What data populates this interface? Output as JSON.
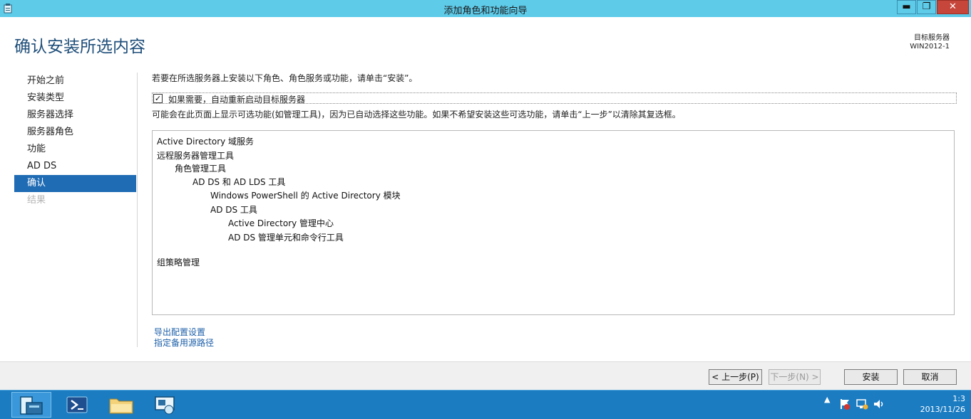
{
  "window": {
    "title": "添加角色和功能向导",
    "min_glyph": "▬",
    "max_glyph": "❐",
    "close_glyph": "✕"
  },
  "header": {
    "page_title": "确认安装所选内容",
    "target_label": "目标服务器",
    "target_server": "WIN2012-1"
  },
  "nav": {
    "items": [
      {
        "label": "开始之前"
      },
      {
        "label": "安装类型"
      },
      {
        "label": "服务器选择"
      },
      {
        "label": "服务器角色"
      },
      {
        "label": "功能"
      },
      {
        "label": "AD DS"
      },
      {
        "label": "确认"
      },
      {
        "label": "结果"
      }
    ]
  },
  "content": {
    "intro": "若要在所选服务器上安装以下角色、角色服务或功能，请单击“安装”。",
    "restart_label": "如果需要，自动重新启动目标服务器",
    "restart_checked": true,
    "note": "可能会在此页面上显示可选功能(如管理工具)，因为已自动选择这些功能。如果不希望安装这些可选功能，请单击“上一步”以清除其复选框。",
    "features": [
      {
        "label": "Active Directory 域服务"
      },
      {
        "label": "远程服务器管理工具"
      },
      {
        "label": "角色管理工具"
      },
      {
        "label": "AD DS 和 AD LDS 工具"
      },
      {
        "label": "Windows PowerShell 的 Active Directory 模块"
      },
      {
        "label": "AD DS 工具"
      },
      {
        "label": "Active Directory 管理中心"
      },
      {
        "label": "AD DS 管理单元和命令行工具"
      },
      {
        "label": "组策略管理"
      }
    ],
    "links": {
      "export": "导出配置设置",
      "alt_source": "指定备用源路径"
    }
  },
  "buttons": {
    "prev": "< 上一步(P)",
    "next": "下一步(N) >",
    "install": "安装",
    "cancel": "取消"
  },
  "taskbar": {
    "tray_arrow": "▲",
    "time": "1:3",
    "date": "2013/11/26"
  }
}
